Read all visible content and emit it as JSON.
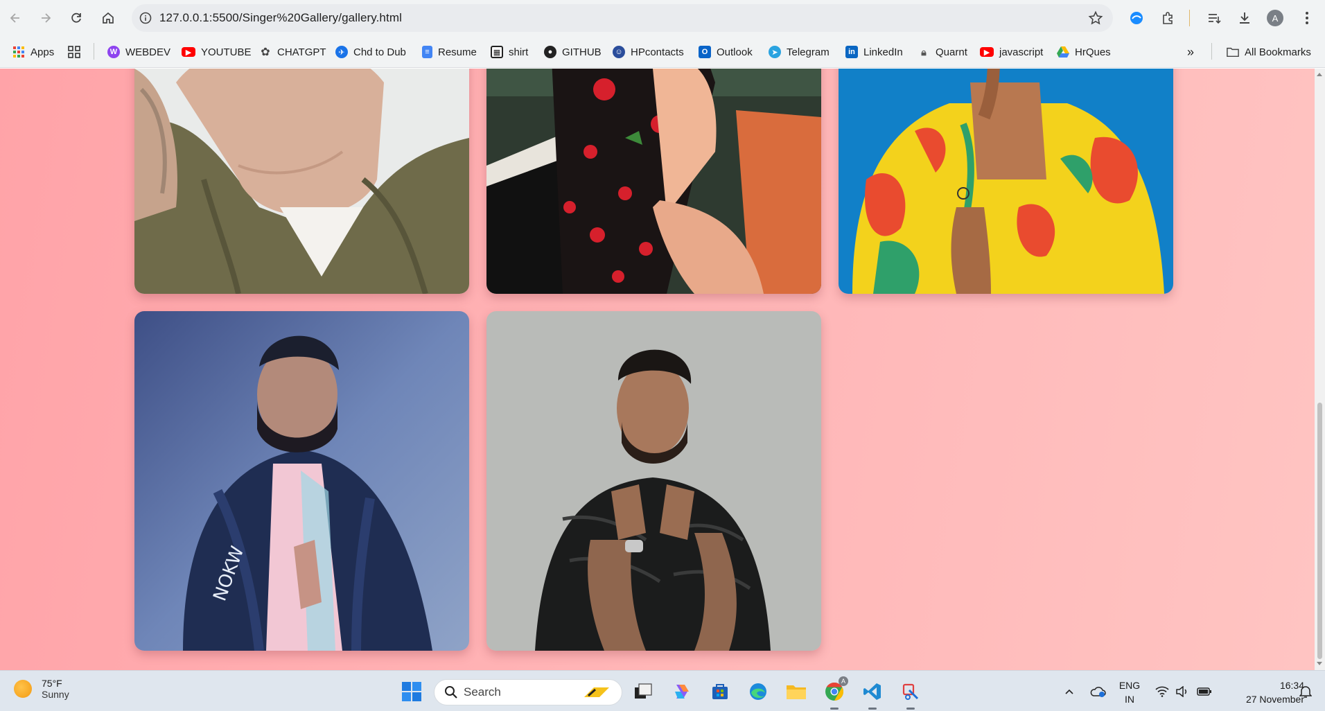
{
  "browser": {
    "url": "127.0.0.1:5500/Singer%20Gallery/gallery.html",
    "profile_initial": "A"
  },
  "bookmarks": [
    {
      "label": "Apps",
      "icon": "apps-grid-icon",
      "color": "#4285f4"
    },
    {
      "label": "WEBDEV",
      "icon": "webdev-icon",
      "color": "#8e44ef"
    },
    {
      "label": "YOUTUBE",
      "icon": "youtube-icon",
      "color": "#ff0000"
    },
    {
      "label": "CHATGPT",
      "icon": "chatgpt-icon",
      "color": "#444444"
    },
    {
      "label": "Chd to Dub",
      "icon": "plane-icon",
      "color": "#1a73e8"
    },
    {
      "label": "Resume",
      "icon": "docs-icon",
      "color": "#4285f4"
    },
    {
      "label": "shirt",
      "icon": "shirt-icon",
      "color": "#222222"
    },
    {
      "label": "GITHUB",
      "icon": "github-icon",
      "color": "#222222"
    },
    {
      "label": "HPcontacts",
      "icon": "hp-icon",
      "color": "#2a4d9b"
    },
    {
      "label": "Outlook",
      "icon": "outlook-icon",
      "color": "#0a64c8"
    },
    {
      "label": "Telegram",
      "icon": "telegram-icon",
      "color": "#2aa3e0"
    },
    {
      "label": "LinkedIn",
      "icon": "linkedin-icon",
      "color": "#0a66c2"
    },
    {
      "label": "Quarnt",
      "icon": "lock-icon",
      "color": "#555555"
    },
    {
      "label": "javascript",
      "icon": "youtube-icon",
      "color": "#ff0000"
    },
    {
      "label": "HrQues",
      "icon": "drive-icon",
      "color": "#fbbc04"
    }
  ],
  "bookmarks_all": "All Bookmarks",
  "gallery": {
    "page_colors": {
      "left": "#ffa3a8",
      "right": "#ffc4c2"
    },
    "cards": [
      {
        "subject": "singer-photo-olive-jacket",
        "row": "top",
        "col": 1
      },
      {
        "subject": "singer-photo-floral-dress",
        "row": "top",
        "col": 2
      },
      {
        "subject": "singer-photo-hawaiian-shirt",
        "row": "top",
        "col": 3
      },
      {
        "subject": "singer-photo-leather-jacket",
        "row": "bottom",
        "col": 1
      },
      {
        "subject": "singer-photo-puffer-jacket",
        "row": "bottom",
        "col": 2
      }
    ]
  },
  "taskbar": {
    "weather_temp": "75°F",
    "weather_desc": "Sunny",
    "search_label": "Search",
    "lang_top": "ENG",
    "lang_bottom": "IN",
    "time": "16:34",
    "date": "27 November"
  }
}
